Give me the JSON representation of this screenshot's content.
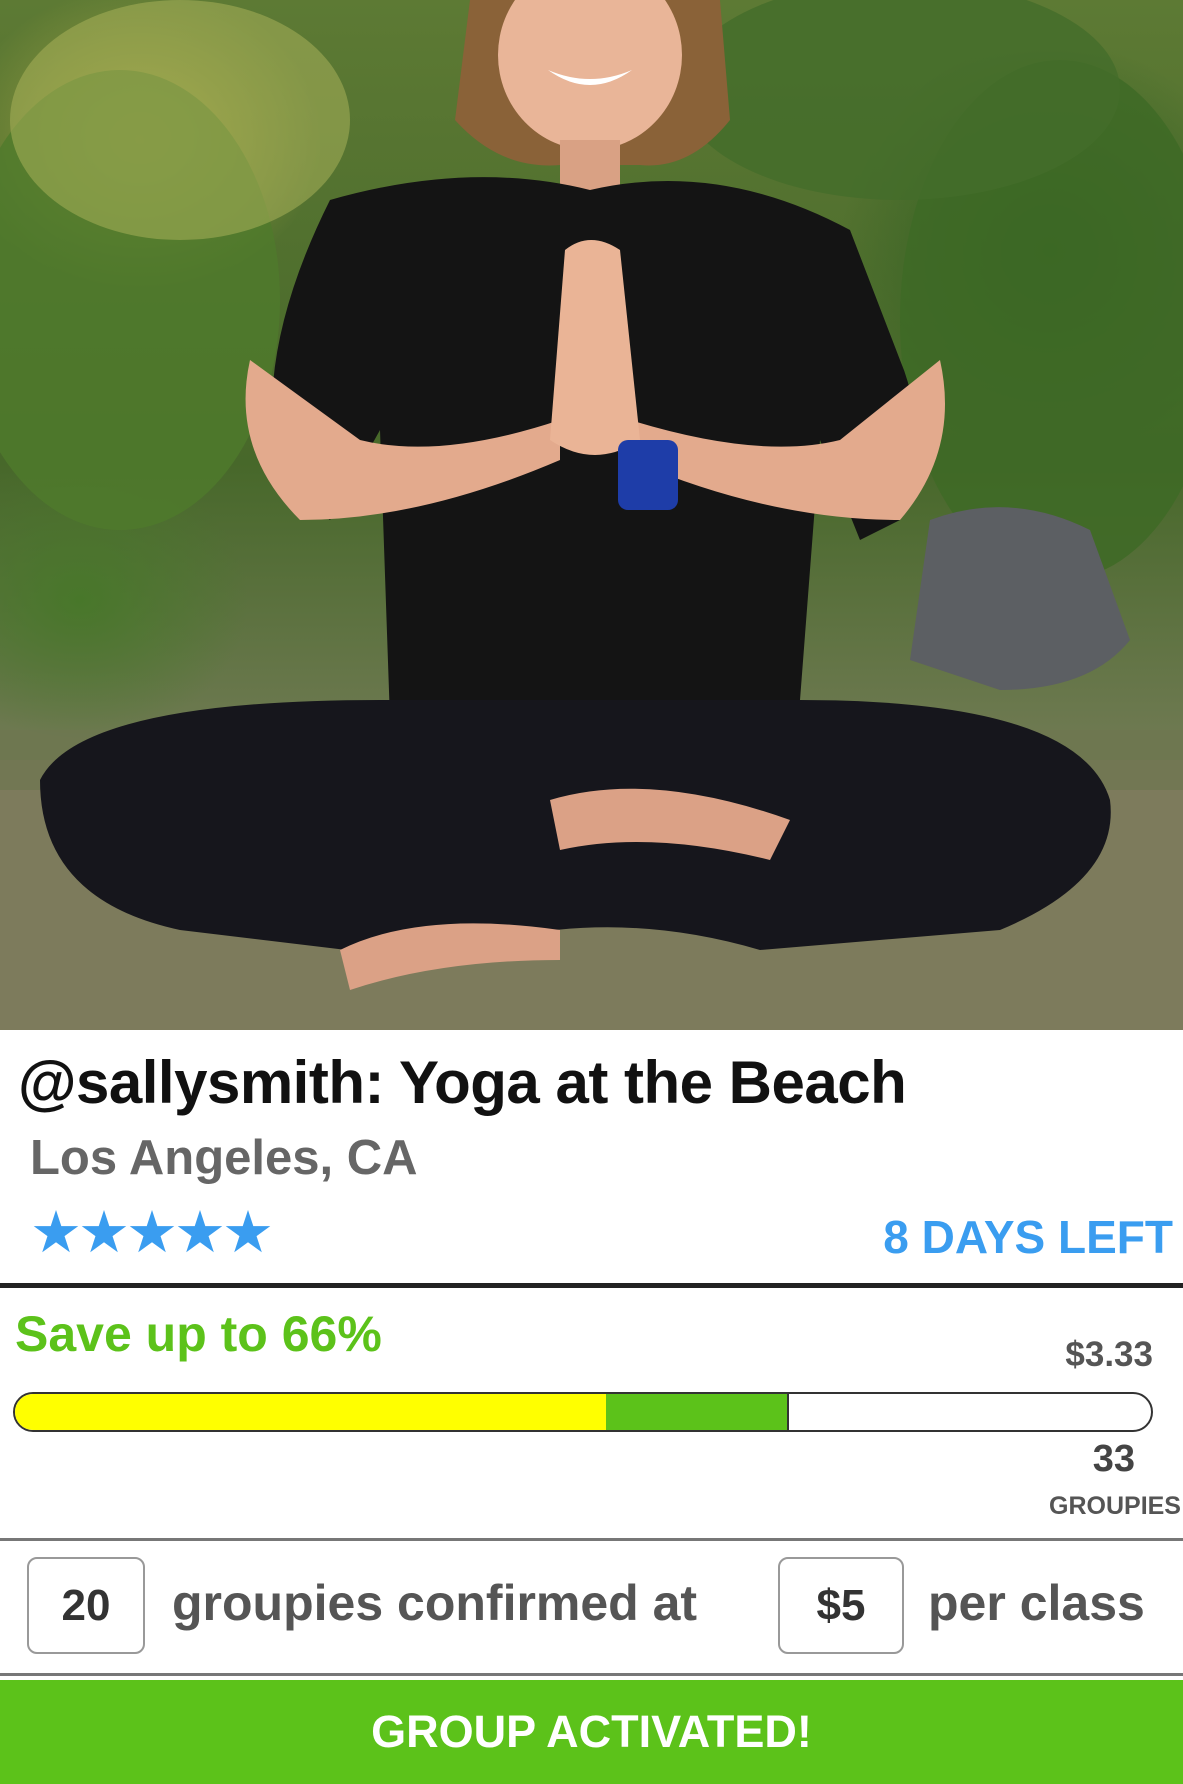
{
  "listing": {
    "title": "@sallysmith: Yoga at the Beach",
    "location": "Los Angeles, CA",
    "rating_stars": "★★★★★",
    "rating": 5,
    "days_left": "8 DAYS LEFT"
  },
  "savings": {
    "headline": "Save up to 66%",
    "target_price": "$3.33",
    "target_groupies": "33",
    "groupies_label": "GROUPIES",
    "progress_confirmed_fraction": 0.52,
    "progress_total_fraction": 0.68
  },
  "confirmation": {
    "count": "20",
    "text_middle": "groupies confirmed at",
    "price": "$5",
    "text_end": "per class"
  },
  "cta": {
    "label": "GROUP ACTIVATED!"
  },
  "colors": {
    "accent_blue": "#3a9df0",
    "accent_green": "#5cc21a",
    "progress_yellow": "#ffff00"
  },
  "photo": {
    "description_icon": "yoga-instructor-photo"
  }
}
